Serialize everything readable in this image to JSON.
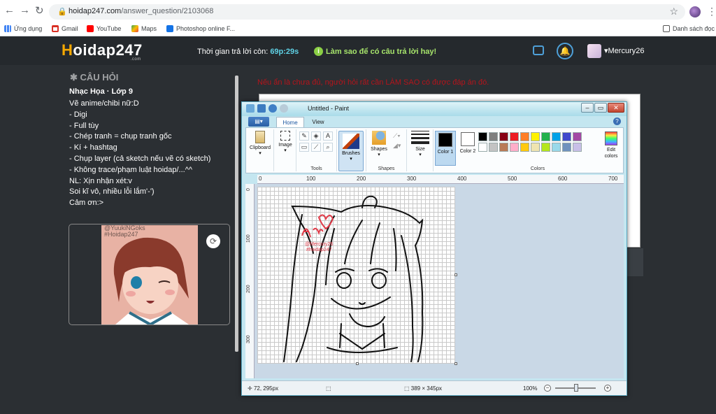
{
  "browser": {
    "url_host": "hoidap247.com",
    "url_path": "/answer_question/2103068",
    "bookmarks": [
      "Ứng dụng",
      "Gmail",
      "YouTube",
      "Maps",
      "Photoshop online F...",
      "Danh sách đọc"
    ]
  },
  "header": {
    "logo_h": "H",
    "logo_rest": "oidap",
    "logo_num": "247",
    "logo_sub": ".com",
    "timer_label": "Thời gian trả lời còn:",
    "timer_value": "69p:29s",
    "tip_text": "Làm sao để có câu trả lời hay!",
    "username": "Mercury26"
  },
  "question": {
    "heading": "✱ CÂU HỎI",
    "subject": "Nhạc Họa · Lớp 9",
    "lines": [
      "Vẽ anime/chibi nữ:D",
      "- Digi",
      "- Full tùy",
      "- Chép tranh = chụp tranh gốc",
      "- Kí + hashtag",
      "- Chụp layer (cả sketch nếu vẽ có sketch)",
      "- Không trace/phạm luật hoidap/...^^",
      "NL: Xịn nhận xét:v",
      "Soi kĩ vô, nhiều lỗi lắm'-')",
      "Cảm ơn:>"
    ],
    "image_watermark_1": "@YuukiNGoks",
    "image_watermark_2": "#Hoidap247"
  },
  "answer": {
    "note": "Nếu ẩn là chưa đủ, người hỏi rất cần LÀM SAO có được đáp án đó."
  },
  "paint": {
    "title": "Untitled - Paint",
    "tabs": [
      "Home",
      "View"
    ],
    "groups": {
      "clipboard": "Clipboard",
      "image": "Image",
      "tools": "Tools",
      "brushes": "Brushes",
      "shapes": "Shapes",
      "size": "Size",
      "color1": "Color 1",
      "color2": "Color 2",
      "colors": "Colors",
      "edit_colors": "Edit colors"
    },
    "palette": [
      "#000000",
      "#7f7f7f",
      "#880015",
      "#ed1c24",
      "#ff7f27",
      "#fff200",
      "#22b14c",
      "#00a2e8",
      "#3f48cc",
      "#a349a4",
      "#ffffff",
      "#c3c3c3",
      "#b97a57",
      "#ffaec9",
      "#ffc90e",
      "#efe4b0",
      "#b5e61d",
      "#99d9ea",
      "#7092be",
      "#c8bfe7"
    ],
    "ruler_h": [
      "0",
      "100",
      "200",
      "300",
      "400",
      "500",
      "600",
      "700"
    ],
    "ruler_v": [
      "0",
      "100",
      "200",
      "300"
    ],
    "signature_tags": [
      "@Mercury26",
      "#hoidap247"
    ],
    "status": {
      "cursor": "72, 295px",
      "size": "389 × 345px",
      "zoom": "100%"
    }
  }
}
